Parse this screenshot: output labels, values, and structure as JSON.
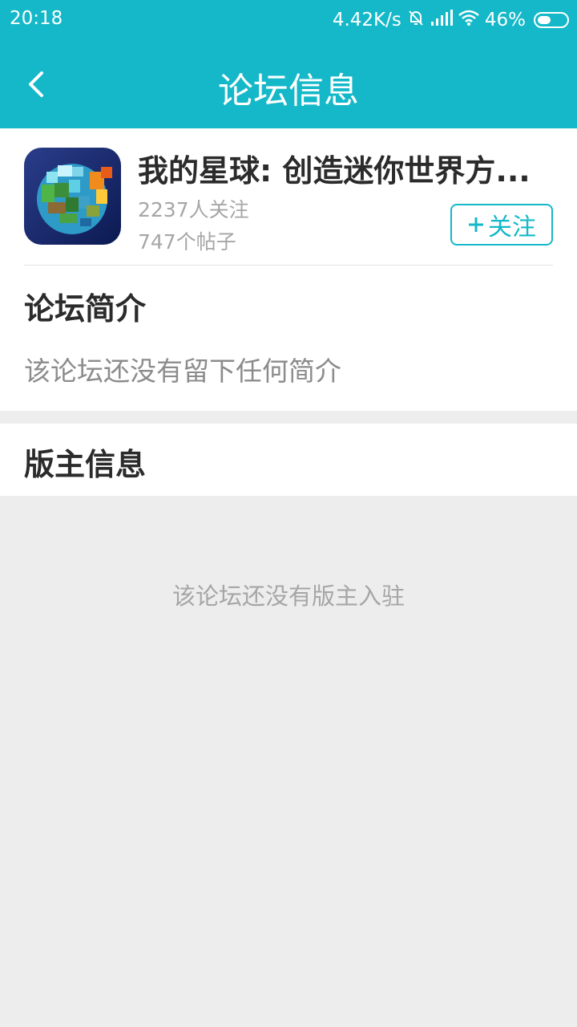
{
  "status_bar": {
    "time": "20:18",
    "net_speed": "4.42K/s",
    "battery": "46%",
    "battery_level": 0.46,
    "icons": [
      "mute-bell-icon",
      "signal-icon",
      "wifi-icon",
      "battery-icon"
    ]
  },
  "app_bar": {
    "back_icon": "chevron-left-icon",
    "title": "论坛信息"
  },
  "forum": {
    "name": "我的星球: 创造迷你世界方...",
    "followers": "2237人关注",
    "posts": "747个帖子",
    "follow_label": "关注",
    "follow_icon": "plus-icon"
  },
  "intro": {
    "heading": "论坛简介",
    "text": "该论坛还没有留下任何简介"
  },
  "moderators": {
    "heading": "版主信息",
    "empty_text": "该论坛还没有版主入驻"
  },
  "colors": {
    "accent": "#14b8c8",
    "background": "#ededed",
    "card": "#ffffff",
    "title_text": "#2b2b2b",
    "muted_text": "#a6a6a6"
  }
}
